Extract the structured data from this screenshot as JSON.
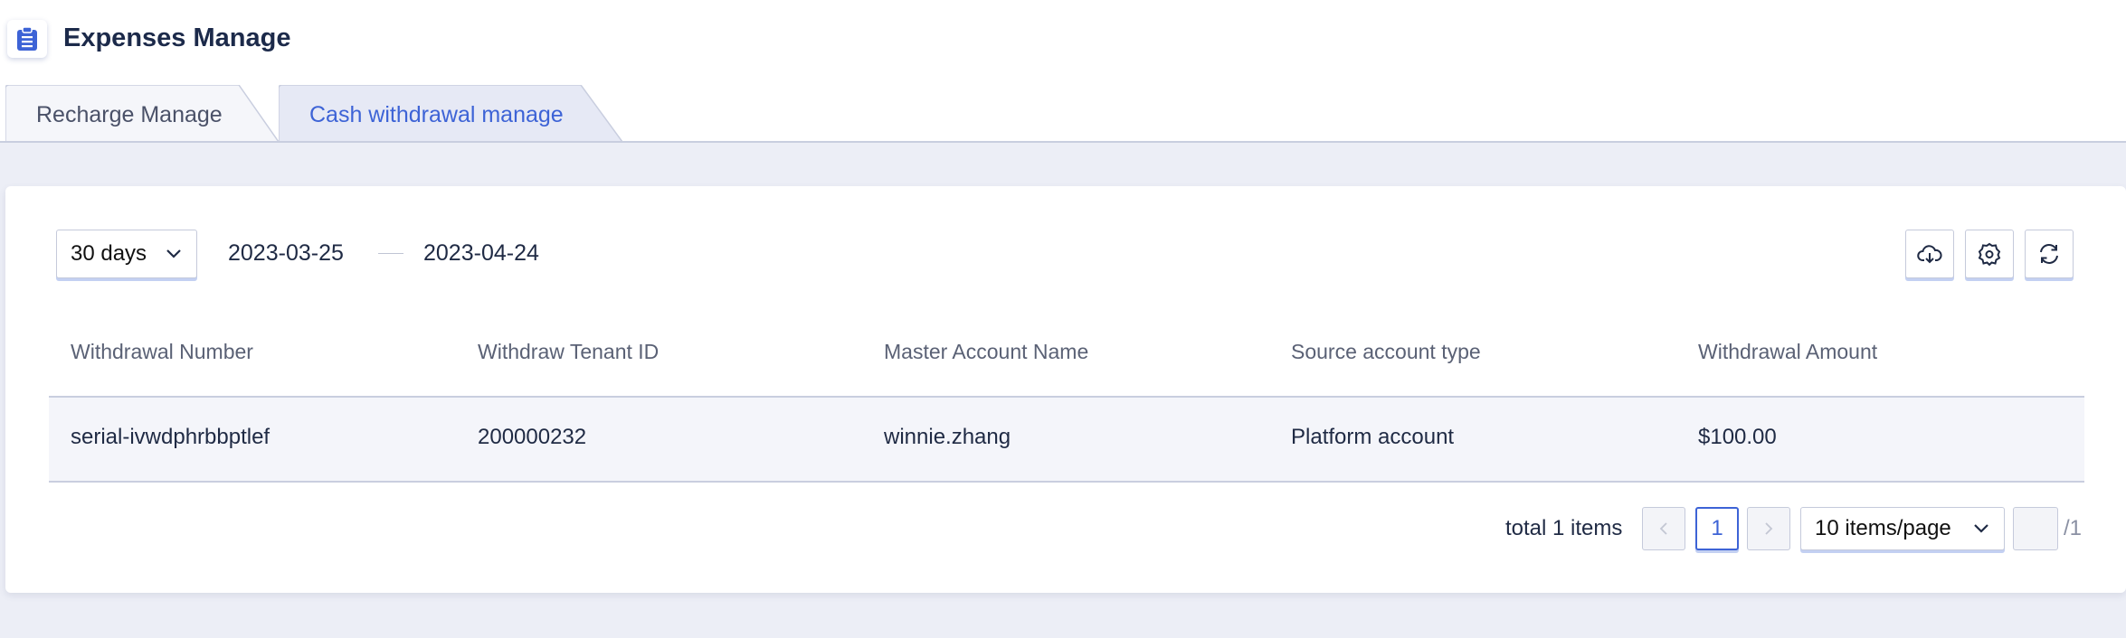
{
  "header": {
    "title": "Expenses Manage"
  },
  "tabs": [
    {
      "label": "Recharge Manage",
      "active": false
    },
    {
      "label": "Cash withdrawal manage",
      "active": true
    }
  ],
  "filters": {
    "range": "30 days",
    "start_date": "2023-03-25",
    "end_date": "2023-04-24"
  },
  "toolbar": {
    "download_icon": "cloud-download-icon",
    "settings_icon": "gear-icon",
    "refresh_icon": "refresh-icon"
  },
  "table": {
    "columns": [
      "Withdrawal Number",
      "Withdraw Tenant ID",
      "Master Account Name",
      "Source account type",
      "Withdrawal Amount"
    ],
    "rows": [
      [
        "serial-ivwdphrbbptlef",
        "200000232",
        "winnie.zhang",
        "Platform account",
        "$100.00"
      ]
    ]
  },
  "pagination": {
    "total_label": "total 1 items",
    "current_page": "1",
    "page_size": "10 items/page",
    "jump_value": "",
    "page_total": "/1"
  },
  "colors": {
    "accent": "#3d63d6",
    "background": "#eceef6",
    "row_background": "#f4f5fa"
  }
}
